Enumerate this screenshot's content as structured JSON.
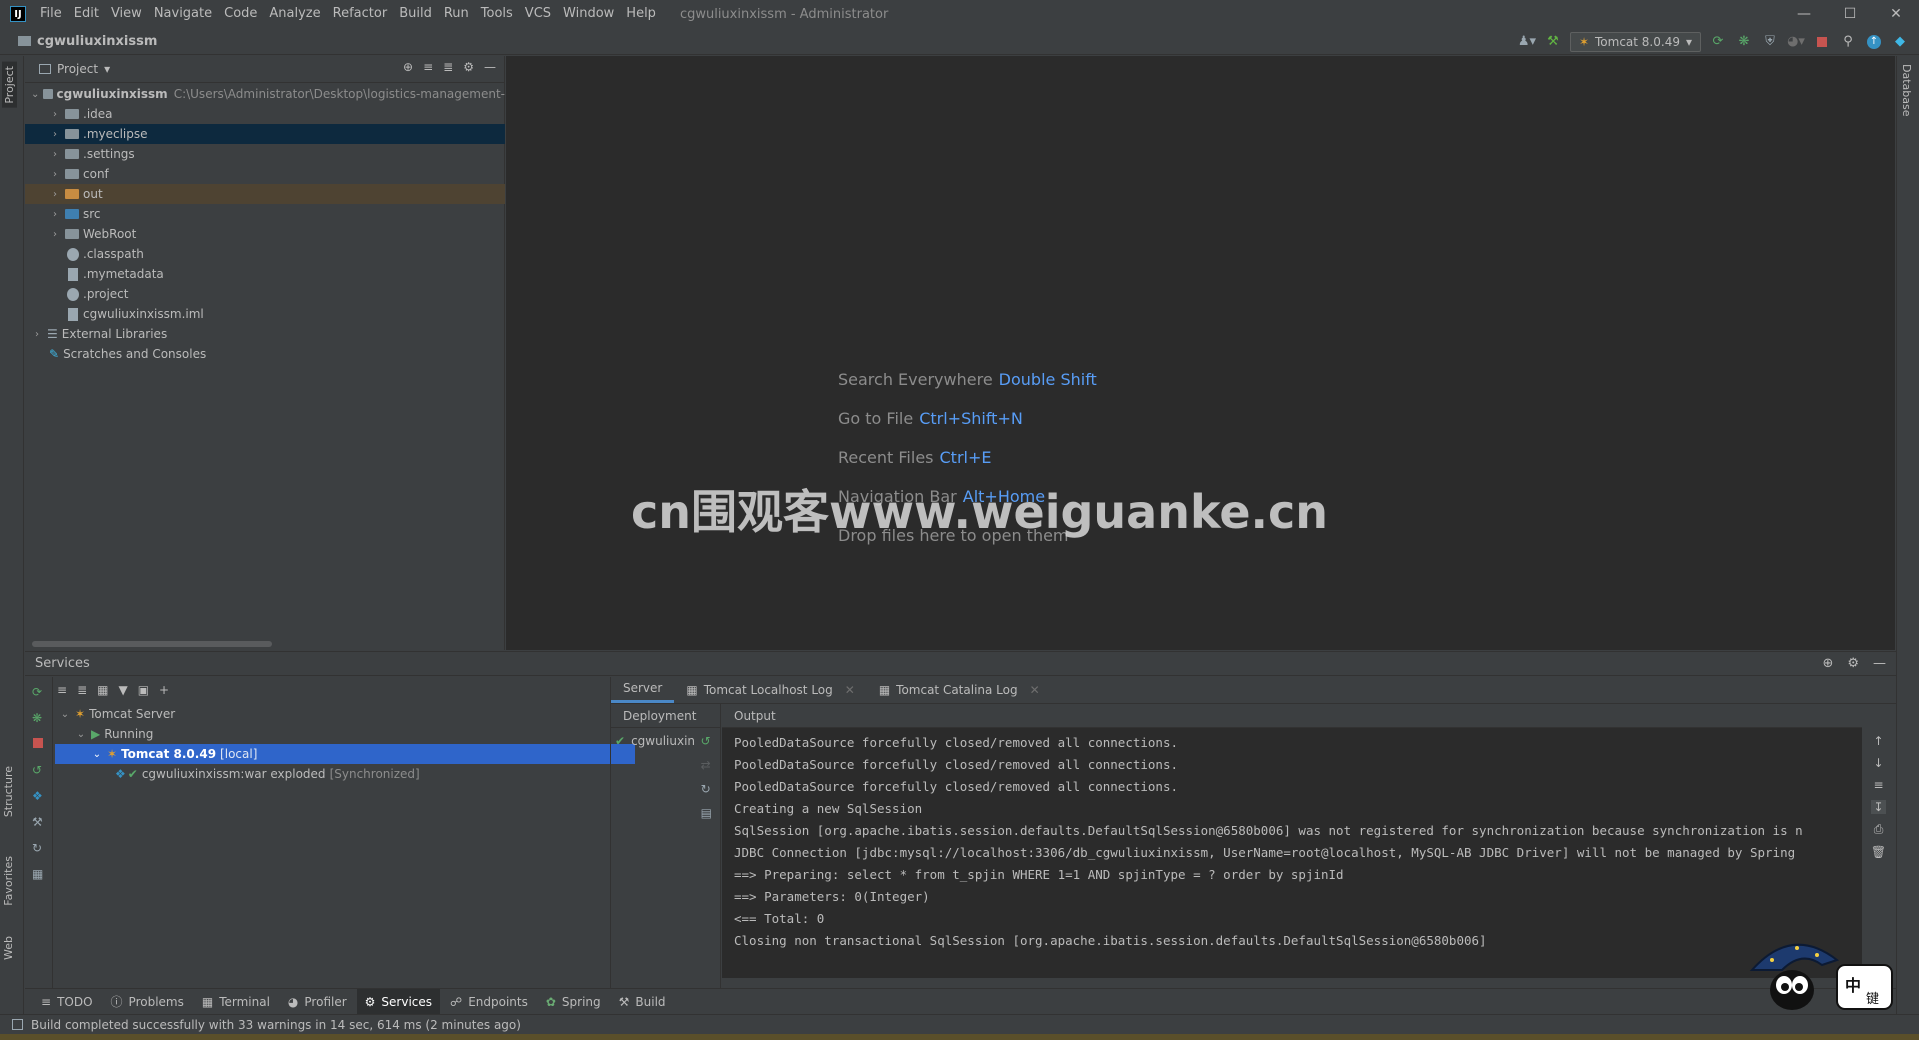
{
  "window": {
    "title": "cgwuliuxinxissm - Administrator",
    "menu": [
      "File",
      "Edit",
      "View",
      "Navigate",
      "Code",
      "Analyze",
      "Refactor",
      "Build",
      "Run",
      "Tools",
      "VCS",
      "Window",
      "Help"
    ]
  },
  "navbar": {
    "project": "cgwuliuxinxissm",
    "run_config": "Tomcat 8.0.49"
  },
  "left_stripe": {
    "project": "Project",
    "structure": "Structure",
    "favorites": "Favorites",
    "web": "Web"
  },
  "right_stripe": {
    "database": "Database"
  },
  "project_panel": {
    "title": "Project",
    "root": {
      "name": "cgwuliuxinxissm",
      "path": "C:\\Users\\Administrator\\Desktop\\logistics-management-"
    },
    "items": [
      {
        "label": ".idea"
      },
      {
        "label": ".myeclipse"
      },
      {
        "label": ".settings"
      },
      {
        "label": "conf"
      },
      {
        "label": "out"
      },
      {
        "label": "src"
      },
      {
        "label": "WebRoot"
      },
      {
        "label": ".classpath"
      },
      {
        "label": ".mymetadata"
      },
      {
        "label": ".project"
      },
      {
        "label": "cgwuliuxinxissm.iml"
      },
      {
        "label": "External Libraries"
      },
      {
        "label": "Scratches and Consoles"
      }
    ]
  },
  "editor": {
    "hints": [
      {
        "label": "Search Everywhere",
        "key": "Double Shift"
      },
      {
        "label": "Go to File",
        "key": "Ctrl+Shift+N"
      },
      {
        "label": "Recent Files",
        "key": "Ctrl+E"
      },
      {
        "label": "Navigation Bar",
        "key": "Alt+Home"
      },
      {
        "label": "Drop files here to open them",
        "key": ""
      }
    ],
    "watermark": "cn围观客www.weiguanke.cn"
  },
  "services": {
    "title": "Services",
    "tree": [
      {
        "label": "Tomcat Server",
        "extra": ""
      },
      {
        "label": "Running",
        "extra": ""
      },
      {
        "label": "Tomcat 8.0.49",
        "extra": "[local]"
      },
      {
        "label": "cgwuliuxinxissm:war exploded",
        "extra": "[Synchronized]"
      }
    ],
    "tabs": [
      {
        "label": "Server"
      },
      {
        "label": "Tomcat Localhost Log"
      },
      {
        "label": "Tomcat Catalina Log"
      }
    ],
    "deployment_header": "Deployment",
    "deployment_item": "cgwuliuxin",
    "output_header": "Output",
    "console": [
      "PooledDataSource forcefully closed/removed all connections.",
      "PooledDataSource forcefully closed/removed all connections.",
      "PooledDataSource forcefully closed/removed all connections.",
      "Creating a new SqlSession",
      "SqlSession [org.apache.ibatis.session.defaults.DefaultSqlSession@6580b006] was not registered for synchronization because synchronization is n",
      "JDBC Connection [jdbc:mysql://localhost:3306/db_cgwuliuxinxissm, UserName=root@localhost, MySQL-AB JDBC Driver] will not be managed by Spring",
      "==>  Preparing: select * from t_spjin WHERE 1=1 AND spjinType = ? order by spjinId",
      "==> Parameters: 0(Integer)",
      "<==      Total: 0",
      "Closing non transactional SqlSession [org.apache.ibatis.session.defaults.DefaultSqlSession@6580b006]"
    ]
  },
  "bottom_tabs": [
    "TODO",
    "Problems",
    "Terminal",
    "Profiler",
    "Services",
    "Endpoints",
    "Spring",
    "Build"
  ],
  "status": "Build completed successfully with 33 warnings in 14 sec, 614 ms (2 minutes ago)",
  "mascot_text": "中",
  "mascot_text2": "键"
}
